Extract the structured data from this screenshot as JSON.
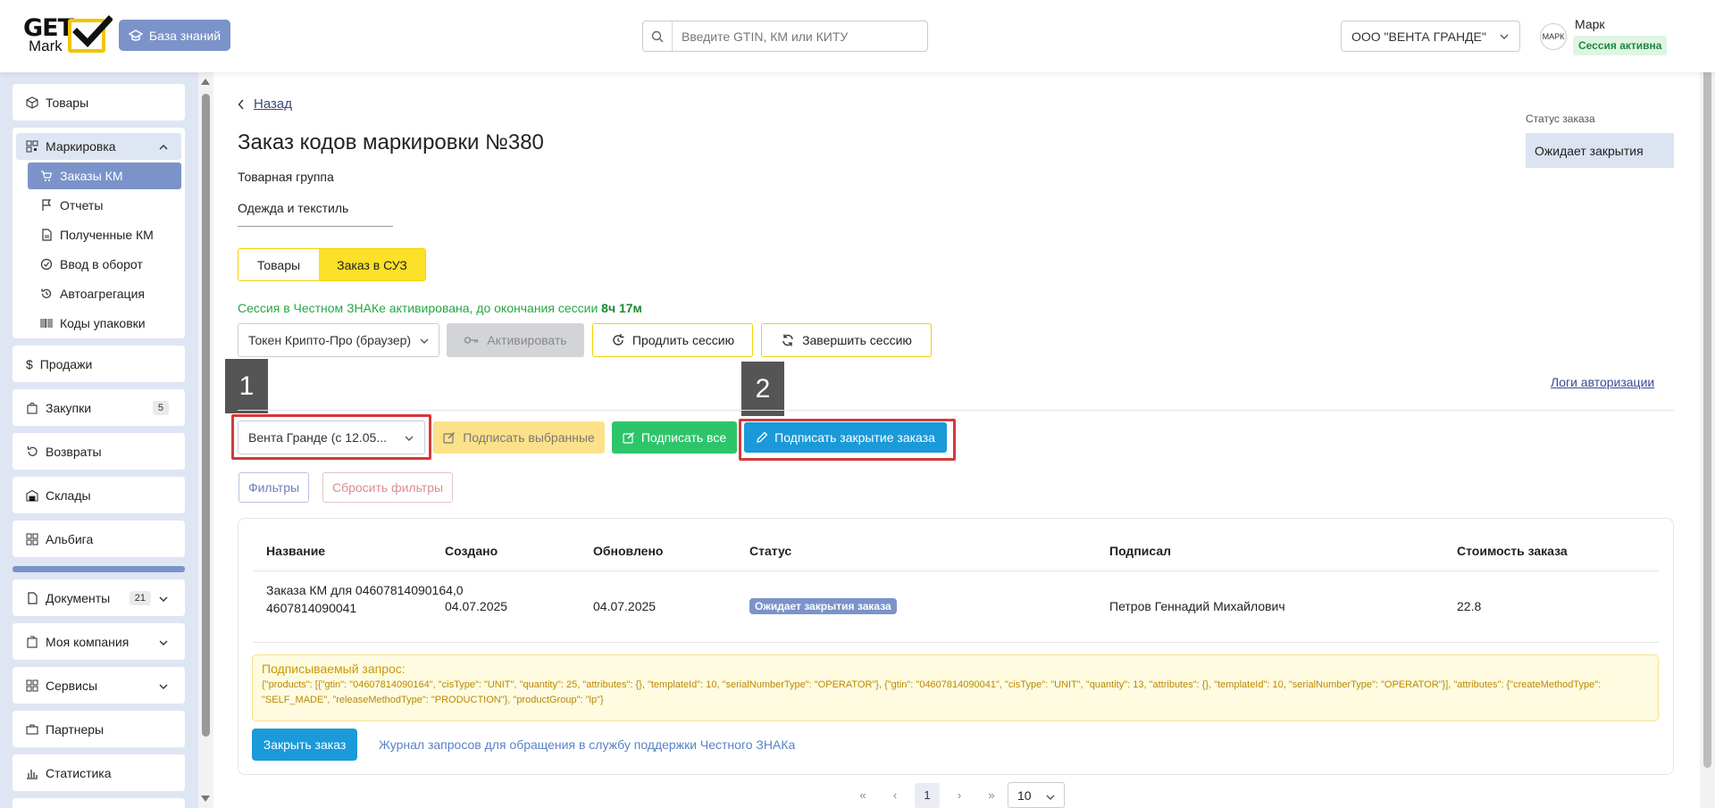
{
  "header": {
    "logo_get": "GET",
    "logo_mark": "Mark",
    "knowledge_base": "База знаний",
    "search_placeholder": "Введите GTIN, КМ или КИТУ",
    "org": "ООО \"ВЕНТА ГРАНДЕ\"",
    "user_name": "Марк",
    "session_status": "Сессия активна",
    "avatar_text": "МАРК"
  },
  "sidebar": {
    "items": {
      "goods": "Товары",
      "marking": "Маркировка",
      "orders_km": "Заказы КМ",
      "reports": "Отчеты",
      "received_km": "Полученные КМ",
      "circulation": "Ввод в оборот",
      "autoaggregation": "Автоагрегация",
      "package_codes": "Коды упаковки",
      "sales": "Продажи",
      "purchases": "Закупки",
      "purchases_count": "5",
      "returns": "Возвраты",
      "warehouses": "Склады",
      "albiga": "Альбига",
      "documents": "Документы",
      "documents_count": "21",
      "my_company": "Моя компания",
      "services": "Сервисы",
      "partners": "Партнеры",
      "statistics": "Статистика"
    }
  },
  "main": {
    "back": "Назад",
    "title": "Заказ кодов маркировки №380",
    "product_group_label": "Товарная группа",
    "product_group_value": "Одежда и текстиль",
    "order_status_label": "Статус заказа",
    "order_status_value": "Ожидает закрытия",
    "tabs": [
      "Товары",
      "Заказ в СУЗ"
    ],
    "session_info_prefix": "Сессия в Честном ЗНАКе активирована, до окончания сессии",
    "session_remaining": "8ч 17м",
    "token_select": "Токен Крипто-Про (браузер)",
    "activate": "Активировать",
    "extend_session": "Продлить сессию",
    "end_session": "Завершить сессию",
    "marker1": "1",
    "marker2": "2",
    "auth_logs": "Логи авторизации",
    "cert_select": "Вента Гранде (с 12.05...",
    "sign_selected": "Подписать выбранные",
    "sign_all": "Подписать все",
    "sign_close": "Подписать закрытие заказа",
    "filters": "Фильтры",
    "reset_filters": "Сбросить фильтры"
  },
  "table": {
    "columns": [
      "Название",
      "Создано",
      "Обновлено",
      "Статус",
      "Подписал",
      "Стоимость заказа"
    ],
    "rows": [
      {
        "name": "Заказа КМ для 04607814090164,04607814090041",
        "created": "04.07.2025",
        "updated": "04.07.2025",
        "status": "Ожидает закрытия заказа",
        "signed_by": "Петров Геннадий Михайлович",
        "cost": "22.8"
      }
    ],
    "request_title": "Подписываемый запрос:",
    "request_body": "{\"products\": [{\"gtin\": \"04607814090164\", \"cisType\": \"UNIT\", \"quantity\": 25, \"attributes\": {}, \"templateId\": 10, \"serialNumberType\": \"OPERATOR\"}, {\"gtin\": \"04607814090041\", \"cisType\": \"UNIT\", \"quantity\": 13, \"attributes\": {}, \"templateId\": 10, \"serialNumberType\": \"OPERATOR\"}], \"attributes\": {\"createMethodType\": \"SELF_MADE\", \"releaseMethodType\": \"PRODUCTION\"}, \"productGroup\": \"lp\"}",
    "close_order": "Закрыть заказ",
    "journal_link": "Журнал запросов для обращения в службу поддержки Честного ЗНАКа"
  },
  "pagination": {
    "first": "«",
    "prev": "‹",
    "current": "1",
    "next": "›",
    "last": "»",
    "page_size": "10"
  },
  "colors": {
    "accent_blue": "#7b93c9",
    "primary_blue": "#1a9ad9",
    "yellow": "#fde028",
    "green": "#2dc56a",
    "highlight_red": "#d33a3a"
  }
}
